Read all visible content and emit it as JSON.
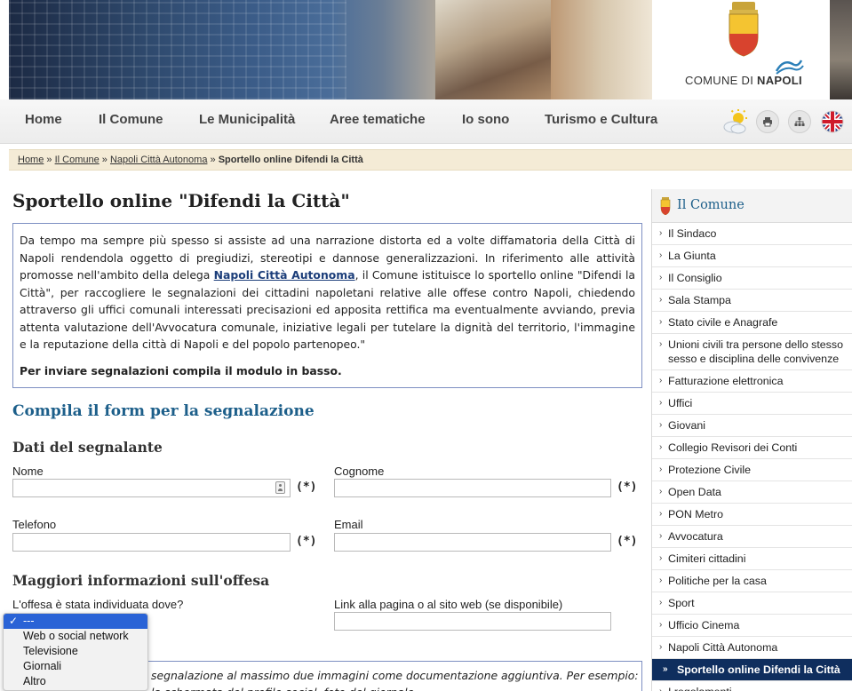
{
  "logo": {
    "city_prefix": "COMUNE DI ",
    "city_name": "NAPOLI"
  },
  "nav": {
    "items": [
      "Home",
      "Il Comune",
      "Le Municipalità",
      "Aree tematiche",
      "Io sono",
      "Turismo e Cultura"
    ],
    "icons": [
      "weather-icon",
      "print-icon",
      "sitemap-icon",
      "english-flag-icon"
    ]
  },
  "breadcrumb": {
    "items": [
      "Home",
      "Il Comune",
      "Napoli Città Autonoma"
    ],
    "separator": "»",
    "current": "Sportello online Difendi la Città"
  },
  "page": {
    "title": "Sportello online \"Difendi la Città\"",
    "intro_before": "Da tempo ma sempre più spesso si assiste ad una narrazione distorta ed a volte diffamatoria della Città di Napoli rendendola oggetto di pregiudizi, stereotipi e dannose generalizzazioni. In riferimento alle attività promosse nell'ambito della delega ",
    "intro_link": "Napoli Città Autonoma",
    "intro_after": ", il Comune istituisce lo sportello online \"Difendi la Città\", per raccogliere le segnalazioni dei cittadini napoletani relative alle offese contro Napoli, chiedendo attraverso gli uffici comunali interessati precisazioni ed apposita rettifica ma eventualmente avviando, previa attenta valutazione dell'Avvocatura comunale, iniziative legali per tutelare la dignità del territorio, l'immagine e la reputazione della città di Napoli e del popolo partenopeo.\"",
    "intro_strong": "Per inviare segnalazioni compila il modulo in basso."
  },
  "form": {
    "title": "Compila il form per la segnalazione",
    "section_dati": "Dati del segnalante",
    "nome_label": "Nome",
    "cognome_label": "Cognome",
    "telefono_label": "Telefono",
    "email_label": "Email",
    "required_mark": "(*)",
    "section_offesa": "Maggiori informazioni sull'offesa",
    "dove_label": "L'offesa è stata individuata dove?",
    "link_label": "Link alla pagina o al sito web (se disponibile)",
    "dropdown_options": [
      "---",
      "Web o social network",
      "Televisione",
      "Giornali",
      "Altro"
    ],
    "selected_option": "---",
    "bottom_text": "segnalazione al massimo due immagini come documentazione aggiuntiva. Per esempio:",
    "bottom_text2": "                    la schermata del profilo social, foto del giornale..."
  },
  "sidebar": {
    "title": "Il Comune",
    "items": [
      "Il Sindaco",
      "La Giunta",
      "Il Consiglio",
      "Sala Stampa",
      "Stato civile e Anagrafe",
      "Unioni civili tra persone dello stesso sesso e disciplina delle convivenze",
      "Fatturazione elettronica",
      "Uffici",
      "Giovani",
      "Collegio Revisori dei Conti",
      "Protezione Civile",
      "Open Data",
      "PON Metro",
      "Avvocatura",
      "Cimiteri cittadini",
      "Politiche per la casa",
      "Sport",
      "Ufficio Cinema",
      "Napoli Città Autonoma",
      "Sportello online Difendi la Città",
      "I regolamenti"
    ],
    "active_index": 19
  },
  "colors": {
    "accent_blue": "#1d5f8a",
    "nav_active_bg": "#0f2e5e",
    "breadcrumb_bg": "#f4ebd6",
    "select_blue": "#2a63d6"
  }
}
